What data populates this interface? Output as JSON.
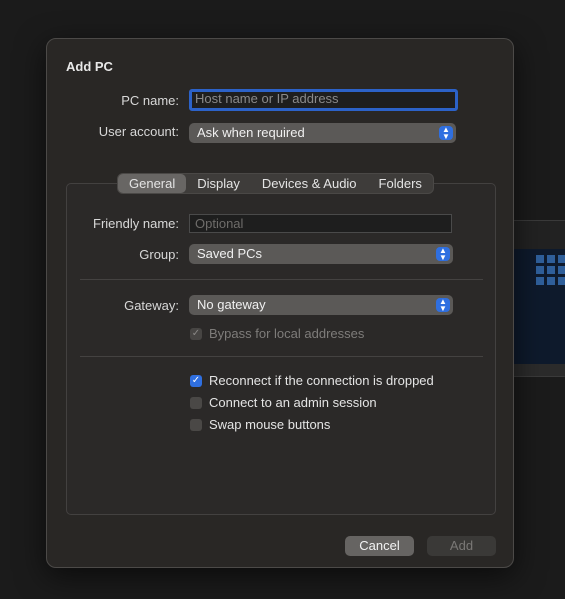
{
  "dialog": {
    "title": "Add PC",
    "pc_name_label": "PC name:",
    "pc_name_placeholder": "Host name or IP address",
    "user_account_label": "User account:",
    "user_account_value": "Ask when required"
  },
  "tabs": [
    "General",
    "Display",
    "Devices & Audio",
    "Folders"
  ],
  "general": {
    "friendly_name_label": "Friendly name:",
    "friendly_name_placeholder": "Optional",
    "group_label": "Group:",
    "group_value": "Saved PCs",
    "gateway_label": "Gateway:",
    "gateway_value": "No gateway",
    "bypass_label": "Bypass for local addresses",
    "reconnect_label": "Reconnect if the connection is dropped",
    "admin_label": "Connect to an admin session",
    "swap_label": "Swap mouse buttons"
  },
  "checkbox_states": {
    "bypass": true,
    "reconnect": true,
    "admin": false,
    "swap": false
  },
  "buttons": {
    "cancel": "Cancel",
    "add": "Add"
  },
  "colors": {
    "accent": "#2f6fe0",
    "sheet": "#292725",
    "focus_ring": "#2c62c8"
  },
  "icons": {
    "check": "checkmark-icon",
    "popup_arrows": "up-down-chevron-icon"
  }
}
